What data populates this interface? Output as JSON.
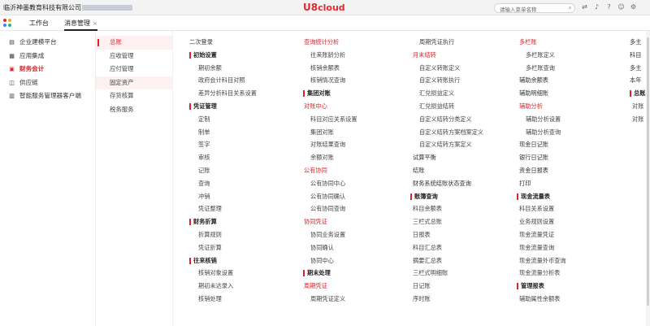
{
  "header": {
    "company": "临沂神墨教育科技有限公司",
    "logo_main": "U8",
    "logo_sub": "cloud",
    "search_placeholder": "请输入菜单名称",
    "icons": [
      "switch-icon",
      "bell-icon",
      "help-icon",
      "user-icon",
      "gear-icon"
    ]
  },
  "tabs": [
    {
      "label": "工作台",
      "active": false
    },
    {
      "label": "消息管理",
      "active": true,
      "closable": "×"
    }
  ],
  "sidebar": {
    "items": [
      {
        "label": "企业建模平台",
        "icon": "building-icon",
        "glyph": "▤",
        "active": false
      },
      {
        "label": "应用集成",
        "icon": "grid-icon",
        "glyph": "▦",
        "active": false
      },
      {
        "label": "财务会计",
        "icon": "finance-icon",
        "glyph": "▣",
        "active": true
      },
      {
        "label": "供应链",
        "icon": "supply-chain-icon",
        "glyph": "◫",
        "active": false
      },
      {
        "label": "智能服务管理器客户端",
        "icon": "service-icon",
        "glyph": "▥",
        "active": false
      }
    ]
  },
  "submenu": {
    "items": [
      {
        "label": "总账",
        "active": true
      },
      {
        "label": "应收管理"
      },
      {
        "label": "应付管理"
      },
      {
        "label": "固定资产",
        "hl": true
      },
      {
        "label": "存货核算"
      },
      {
        "label": "税务服务"
      }
    ]
  },
  "menu": {
    "col1": [
      {
        "t": "二次登录",
        "k": "top"
      },
      {
        "t": "初始设置",
        "k": "head"
      },
      {
        "t": "期初余额",
        "k": "leaf"
      },
      {
        "t": "政府会计科目对照",
        "k": "leaf"
      },
      {
        "t": "差异分析科目关系设置",
        "k": "leaf"
      },
      {
        "t": "凭证管理",
        "k": "head"
      },
      {
        "t": "定制",
        "k": "leaf"
      },
      {
        "t": "制单",
        "k": "leaf"
      },
      {
        "t": "签字",
        "k": "leaf"
      },
      {
        "t": "审核",
        "k": "leaf"
      },
      {
        "t": "记账",
        "k": "leaf"
      },
      {
        "t": "查询",
        "k": "leaf"
      },
      {
        "t": "冲销",
        "k": "leaf"
      },
      {
        "t": "凭证整理",
        "k": "leaf"
      },
      {
        "t": "财务折算",
        "k": "head"
      },
      {
        "t": "折算规则",
        "k": "leaf"
      },
      {
        "t": "凭证折算",
        "k": "leaf"
      },
      {
        "t": "往来核销",
        "k": "head"
      },
      {
        "t": "核销对象设置",
        "k": "leaf"
      },
      {
        "t": "期初未达录入",
        "k": "leaf"
      },
      {
        "t": "核销处理",
        "k": "leaf"
      }
    ],
    "col2": [
      {
        "t": "查询统计分析",
        "k": "cat"
      },
      {
        "t": "往来账龄分析",
        "k": "leaf"
      },
      {
        "t": "核销余额表",
        "k": "leaf"
      },
      {
        "t": "核销情况查询",
        "k": "leaf"
      },
      {
        "t": "集团对账",
        "k": "head"
      },
      {
        "t": "对账中心",
        "k": "cat"
      },
      {
        "t": "科目对应关系设置",
        "k": "leaf"
      },
      {
        "t": "集团对账",
        "k": "leaf"
      },
      {
        "t": "对账结果查询",
        "k": "leaf"
      },
      {
        "t": "余额对账",
        "k": "leaf"
      },
      {
        "t": "公有协同",
        "k": "cat"
      },
      {
        "t": "公有协同中心",
        "k": "leaf"
      },
      {
        "t": "公有协同确认",
        "k": "leaf"
      },
      {
        "t": "公有协同查询",
        "k": "leaf"
      },
      {
        "t": "协同凭证",
        "k": "cat"
      },
      {
        "t": "协同业务设置",
        "k": "leaf"
      },
      {
        "t": "协同确认",
        "k": "leaf"
      },
      {
        "t": "协同中心",
        "k": "leaf"
      },
      {
        "t": "期末处理",
        "k": "head"
      },
      {
        "t": "周期凭证",
        "k": "cat"
      },
      {
        "t": "周期凭证定义",
        "k": "leaf"
      }
    ],
    "col3": [
      {
        "t": "周期凭证执行",
        "k": "leaf"
      },
      {
        "t": "月末结转",
        "k": "cat"
      },
      {
        "t": "自定义转账定义",
        "k": "leaf"
      },
      {
        "t": "自定义转账执行",
        "k": "leaf"
      },
      {
        "t": "汇兑损益定义",
        "k": "leaf"
      },
      {
        "t": "汇兑损益结转",
        "k": "leaf"
      },
      {
        "t": "自定义结转分类定义",
        "k": "leaf"
      },
      {
        "t": "自定义结转方案档案定义",
        "k": "leaf"
      },
      {
        "t": "自定义结转方案定义",
        "k": "leaf"
      },
      {
        "t": "试算平衡",
        "k": "top"
      },
      {
        "t": "结账",
        "k": "top"
      },
      {
        "t": "财务系统结账状态查询",
        "k": "top"
      },
      {
        "t": "账簿查询",
        "k": "head"
      },
      {
        "t": "科目余额表",
        "k": "leaf"
      },
      {
        "t": "三栏式总账",
        "k": "leaf"
      },
      {
        "t": "日报表",
        "k": "leaf"
      },
      {
        "t": "科目汇总表",
        "k": "leaf"
      },
      {
        "t": "摘要汇总表",
        "k": "leaf"
      },
      {
        "t": "三栏式明细账",
        "k": "leaf"
      },
      {
        "t": "日记账",
        "k": "leaf"
      },
      {
        "t": "序时账",
        "k": "leaf"
      }
    ],
    "col4": [
      {
        "t": "多栏账",
        "k": "cat"
      },
      {
        "t": "多栏账定义",
        "k": "leaf"
      },
      {
        "t": "多栏账查询",
        "k": "leaf"
      },
      {
        "t": "辅助余额表",
        "k": "top"
      },
      {
        "t": "辅助明细账",
        "k": "top"
      },
      {
        "t": "辅助分析",
        "k": "cat"
      },
      {
        "t": "辅助分析设置",
        "k": "leaf"
      },
      {
        "t": "辅助分析查询",
        "k": "leaf"
      },
      {
        "t": "现金日记账",
        "k": "top"
      },
      {
        "t": "银行日记账",
        "k": "top"
      },
      {
        "t": "资金日报表",
        "k": "top"
      },
      {
        "t": "打印",
        "k": "top"
      },
      {
        "t": "现金流量表",
        "k": "head"
      },
      {
        "t": "科目关系设置",
        "k": "leaf"
      },
      {
        "t": "业务规则设置",
        "k": "leaf"
      },
      {
        "t": "现金流量凭证",
        "k": "leaf"
      },
      {
        "t": "现金流量查询",
        "k": "leaf"
      },
      {
        "t": "现金流量外币查询",
        "k": "leaf"
      },
      {
        "t": "现金流量分析表",
        "k": "leaf"
      },
      {
        "t": "管理报表",
        "k": "head"
      },
      {
        "t": "辅助属性余额表",
        "k": "leaf"
      }
    ],
    "col5": [
      {
        "t": "多主",
        "k": "top"
      },
      {
        "t": "科目",
        "k": "top"
      },
      {
        "t": "多主",
        "k": "top"
      },
      {
        "t": "本年",
        "k": "top"
      },
      {
        "t": "总账与",
        "k": "head"
      },
      {
        "t": "对账",
        "k": "leaf"
      },
      {
        "t": "对账",
        "k": "leaf"
      }
    ]
  }
}
